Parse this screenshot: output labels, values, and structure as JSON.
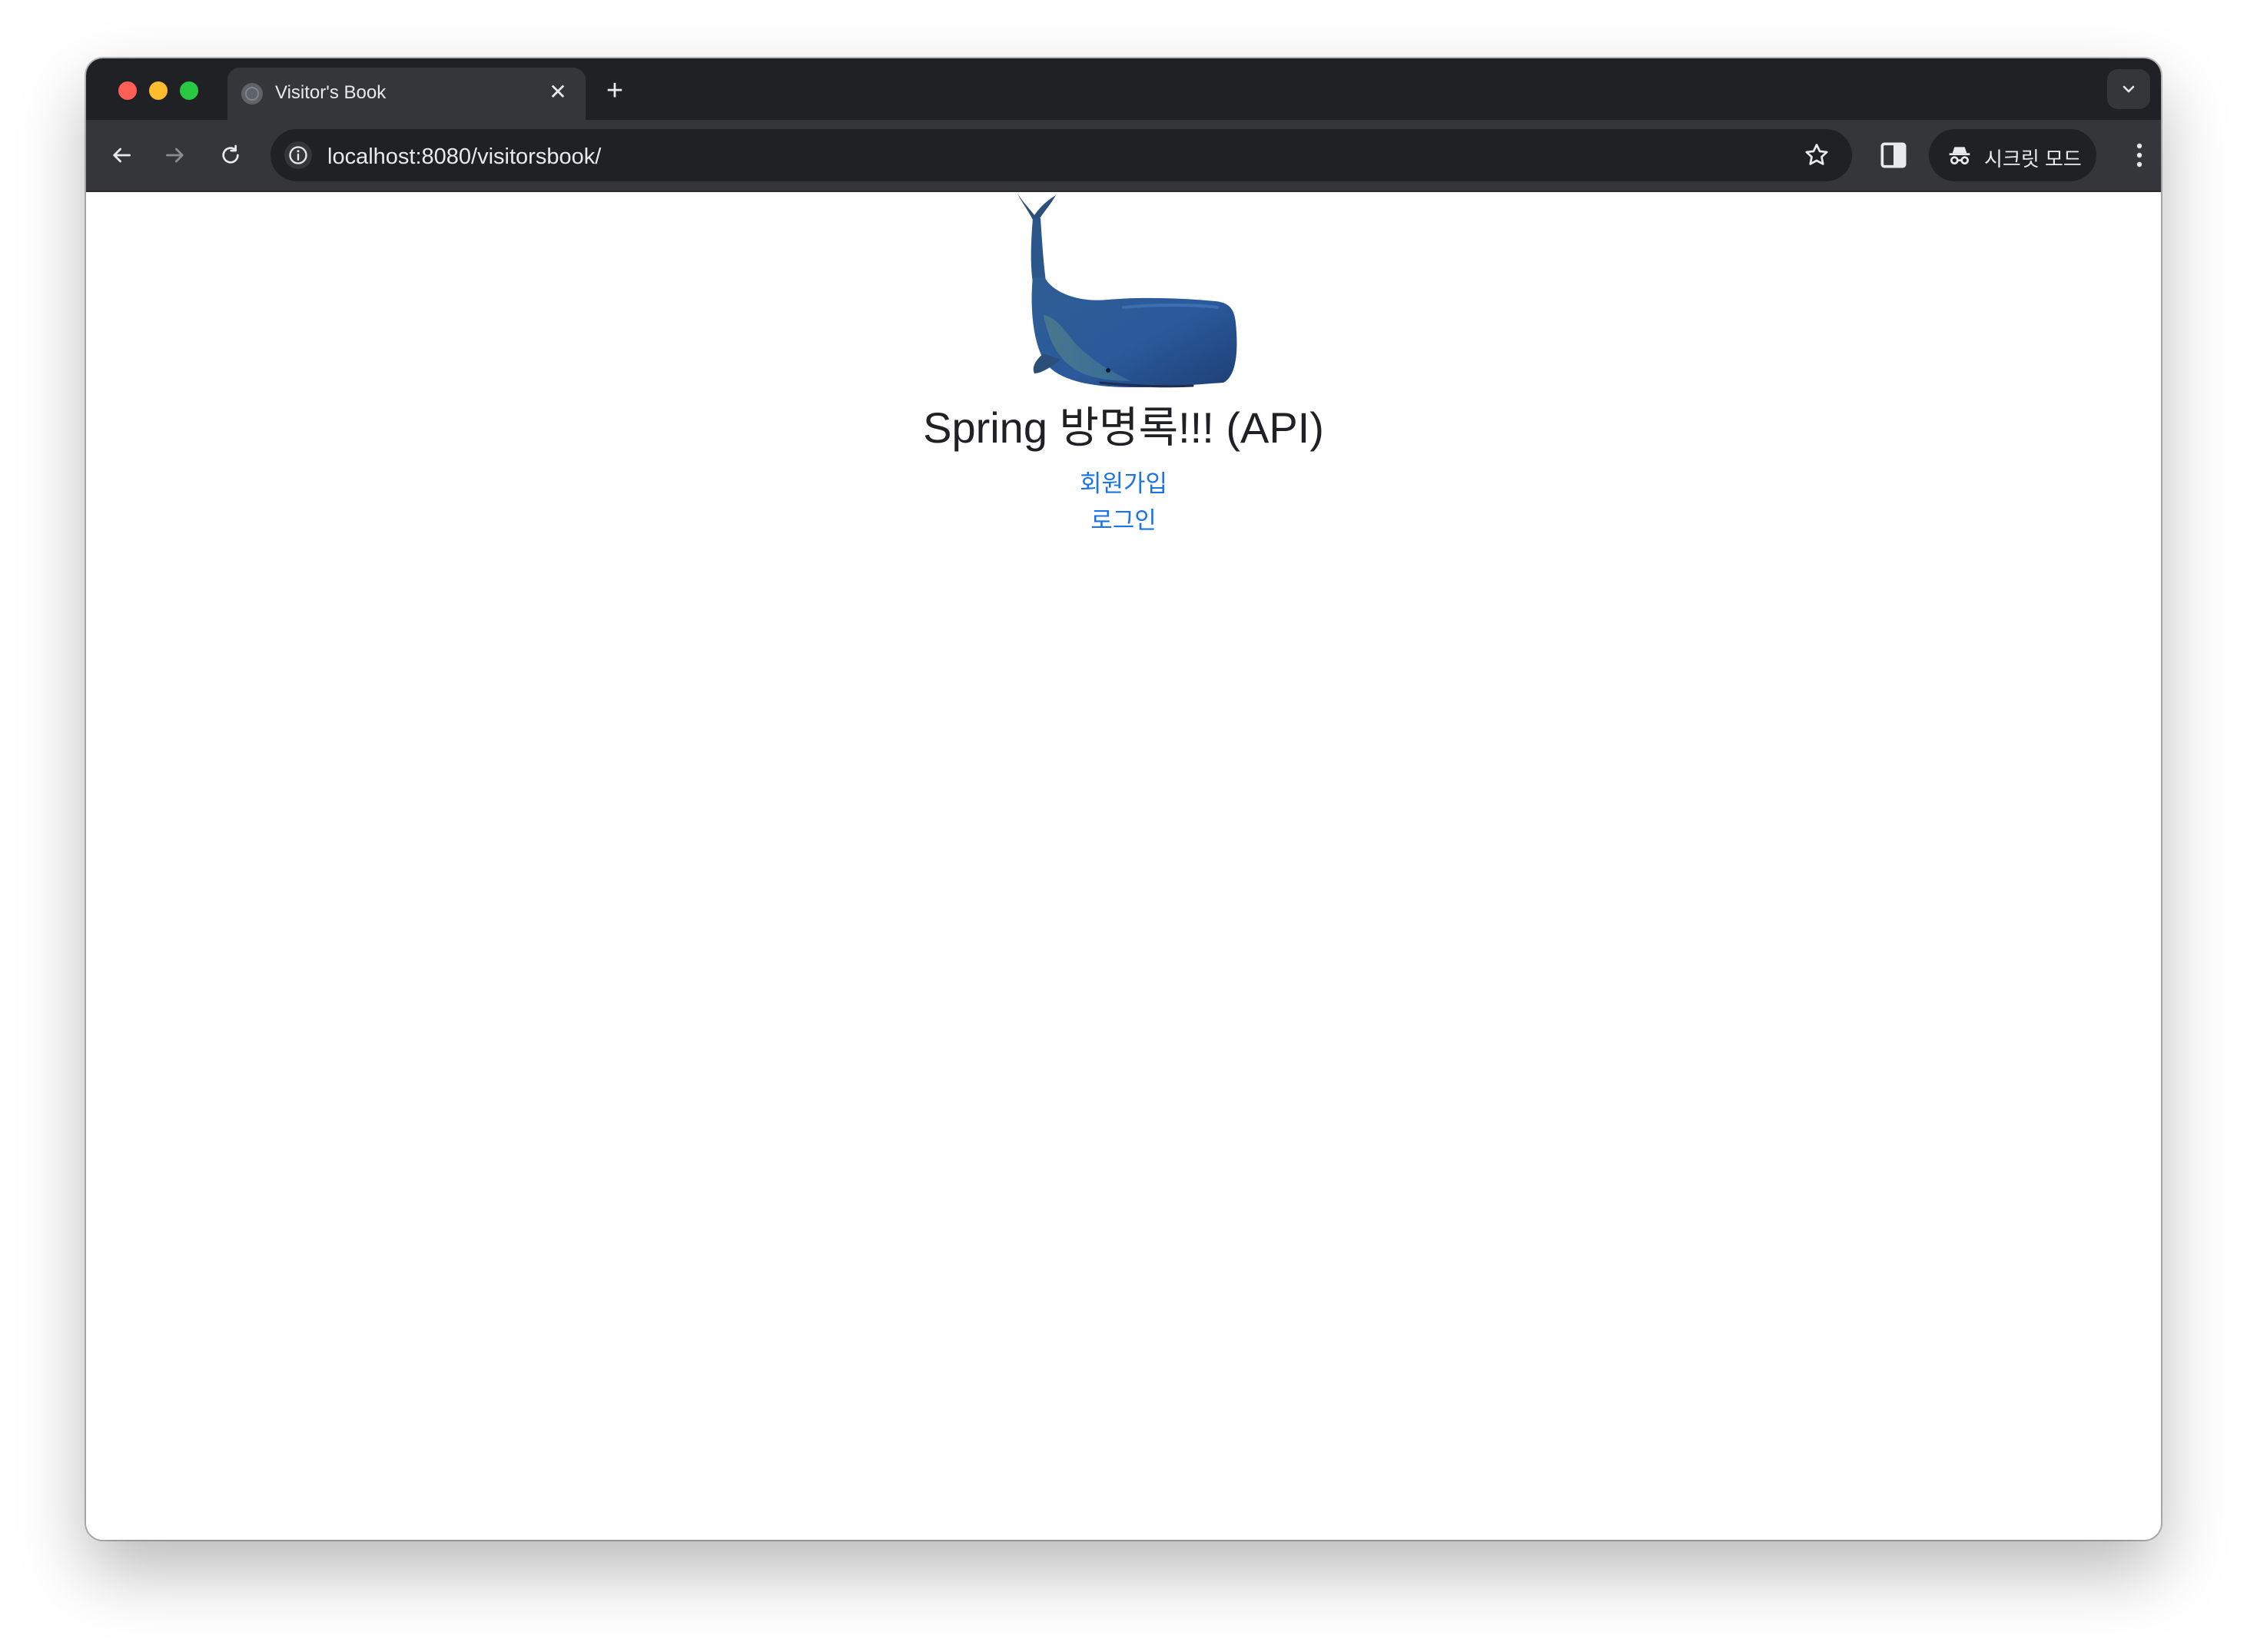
{
  "browser": {
    "tab": {
      "title": "Visitor's Book",
      "close_symbol": "✕"
    },
    "new_tab_symbol": "+",
    "address_bar": {
      "host": "localhost",
      "path": ":8080/visitorsbook/"
    },
    "incognito_label": "시크릿 모드",
    "icons": [
      "globe-icon",
      "close-icon",
      "plus-icon",
      "chevron-down-icon",
      "back-arrow-icon",
      "forward-arrow-icon",
      "reload-icon",
      "info-icon",
      "star-icon",
      "side-panel-icon",
      "incognito-icon",
      "more-vert-icon"
    ]
  },
  "page": {
    "logo": "whale-image",
    "title": "Spring 방명록!!! (API)",
    "links": {
      "signup": "회원가입",
      "login": "로그인"
    },
    "link_color": "#1a73e8"
  }
}
